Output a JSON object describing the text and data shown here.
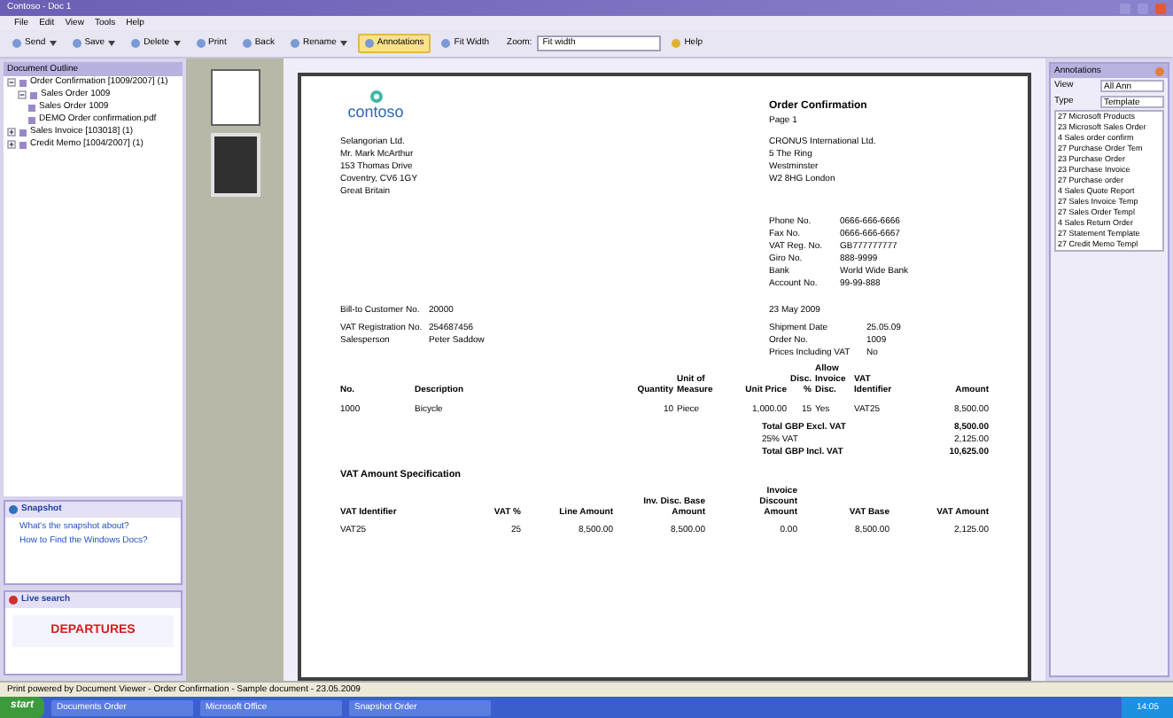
{
  "window": {
    "title": "Contoso - Doc 1"
  },
  "menu": [
    "File",
    "Edit",
    "View",
    "Tools",
    "Help"
  ],
  "toolbar": [
    {
      "label": "Send",
      "kind": "dropdown",
      "selected": false
    },
    {
      "label": "Save",
      "kind": "dropdown",
      "selected": false
    },
    {
      "label": "Delete",
      "kind": "dropdown",
      "selected": false
    },
    {
      "label": "Print",
      "kind": "button",
      "selected": false
    },
    {
      "label": "Back",
      "kind": "button",
      "selected": false
    },
    {
      "label": "Rename",
      "kind": "dropdown",
      "selected": false
    },
    {
      "label": "Annotations",
      "kind": "button",
      "selected": true
    },
    {
      "label": "Fit Width",
      "kind": "button",
      "selected": false
    }
  ],
  "zoom": {
    "label": "Zoom:",
    "value": "Fit width"
  },
  "help": "Help",
  "outline": {
    "title": "Document Outline",
    "items": [
      {
        "label": "Order Confirmation [1009/2007] (1)",
        "expanded": true,
        "children": [
          {
            "label": "Sales Order 1009",
            "expanded": true,
            "children": [
              {
                "label": "Sales Order 1009"
              },
              {
                "label": "DEMO Order confirmation.pdf"
              }
            ]
          }
        ]
      },
      {
        "label": "Sales Invoice [103018] (1)",
        "expanded": false
      },
      {
        "label": "Credit Memo [1004/2007] (1)",
        "expanded": false
      }
    ]
  },
  "panels": [
    {
      "title": "Snapshot",
      "kind": "links",
      "links": [
        "What's the snapshot about?",
        "How to Find the Windows Docs?"
      ]
    },
    {
      "title": "Live search",
      "kind": "ad",
      "text": "DEPARTURES"
    }
  ],
  "document": {
    "logo": "contoso",
    "title": "Order Confirmation",
    "page": "Page 1",
    "customer_address": [
      "Selangorian Ltd.",
      "Mr. Mark McArthur",
      "153 Thomas Drive",
      "Coventry, CV6 1GY",
      "Great Britain"
    ],
    "company_address": [
      "CRONUS International Ltd.",
      "5 The Ring",
      "Westminster",
      "W2 8HG London"
    ],
    "company_info": [
      {
        "label": "Phone No.",
        "value": "0666-666-6666"
      },
      {
        "label": "Fax No.",
        "value": "0666-666-6667"
      },
      {
        "label": "VAT Reg. No.",
        "value": "GB777777777"
      },
      {
        "label": "Giro No.",
        "value": "888-9999"
      },
      {
        "label": "Bank",
        "value": "World Wide Bank"
      },
      {
        "label": "Account No.",
        "value": "99-99-888"
      }
    ],
    "left_info": [
      {
        "label": "Bill-to Customer No.",
        "value": "20000"
      },
      {
        "label": "VAT Registration No.",
        "value": "254687456"
      },
      {
        "label": "Salesperson",
        "value": "Peter Saddow"
      }
    ],
    "date": "23 May 2009",
    "order_info": [
      {
        "label": "Shipment Date",
        "value": "25.05.09"
      },
      {
        "label": "Order No.",
        "value": "1009"
      },
      {
        "label": "Prices Including VAT",
        "value": "No"
      }
    ],
    "lines": {
      "columns": [
        "No.",
        "Description",
        "Quantity",
        "Unit of\nMeasure",
        "Unit Price",
        "Disc.\n%",
        "Allow\nInvoice\nDisc.",
        "VAT\nIdentifier",
        "Amount"
      ],
      "rows": [
        [
          "1000",
          "Bicycle",
          "10",
          "Piece",
          "1,000.00",
          "15",
          "Yes",
          "VAT25",
          "8,500.00"
        ]
      ]
    },
    "totals": [
      {
        "label": "Total GBP Excl. VAT",
        "value": "8,500.00",
        "bold": true
      },
      {
        "label": "25% VAT",
        "value": "2,125.00",
        "bold": false
      },
      {
        "label": "Total GBP Incl. VAT",
        "value": "10,625.00",
        "bold": true
      }
    ],
    "vat_spec": {
      "title": "VAT Amount Specification",
      "columns": [
        "VAT Identifier",
        "VAT %",
        "Line Amount",
        "Inv. Disc. Base\nAmount",
        "Invoice\nDiscount\nAmount",
        "VAT Base",
        "VAT Amount"
      ],
      "rows": [
        [
          "VAT25",
          "25",
          "8,500.00",
          "8,500.00",
          "0.00",
          "8,500.00",
          "2,125.00"
        ]
      ]
    }
  },
  "annotations": {
    "title": "Annotations",
    "filters": [
      {
        "label": "View",
        "value": "All Ann"
      },
      {
        "label": "Type",
        "value": "Template"
      }
    ],
    "items": [
      "27 Microsoft Products",
      "23 Microsoft Sales Order",
      "4 Sales order confirm",
      "27 Purchase Order Tem",
      "23 Purchase Order",
      "23 Purchase Invoice",
      "27 Purchase order",
      "4 Sales Quote Report",
      "27 Sales Invoice Temp",
      "27 Sales Order Templ",
      "4 Sales Return Order",
      "27 Statement Template",
      "27 Credit Memo Templ"
    ]
  },
  "status_bar": "Print powered by Document Viewer - Order Confirmation - Sample document - 23.05.2009",
  "taskbar": {
    "start": "start",
    "tasks": [
      "Documents Order",
      "Microsoft Office",
      "Snapshot Order"
    ],
    "tray": "14:05"
  }
}
